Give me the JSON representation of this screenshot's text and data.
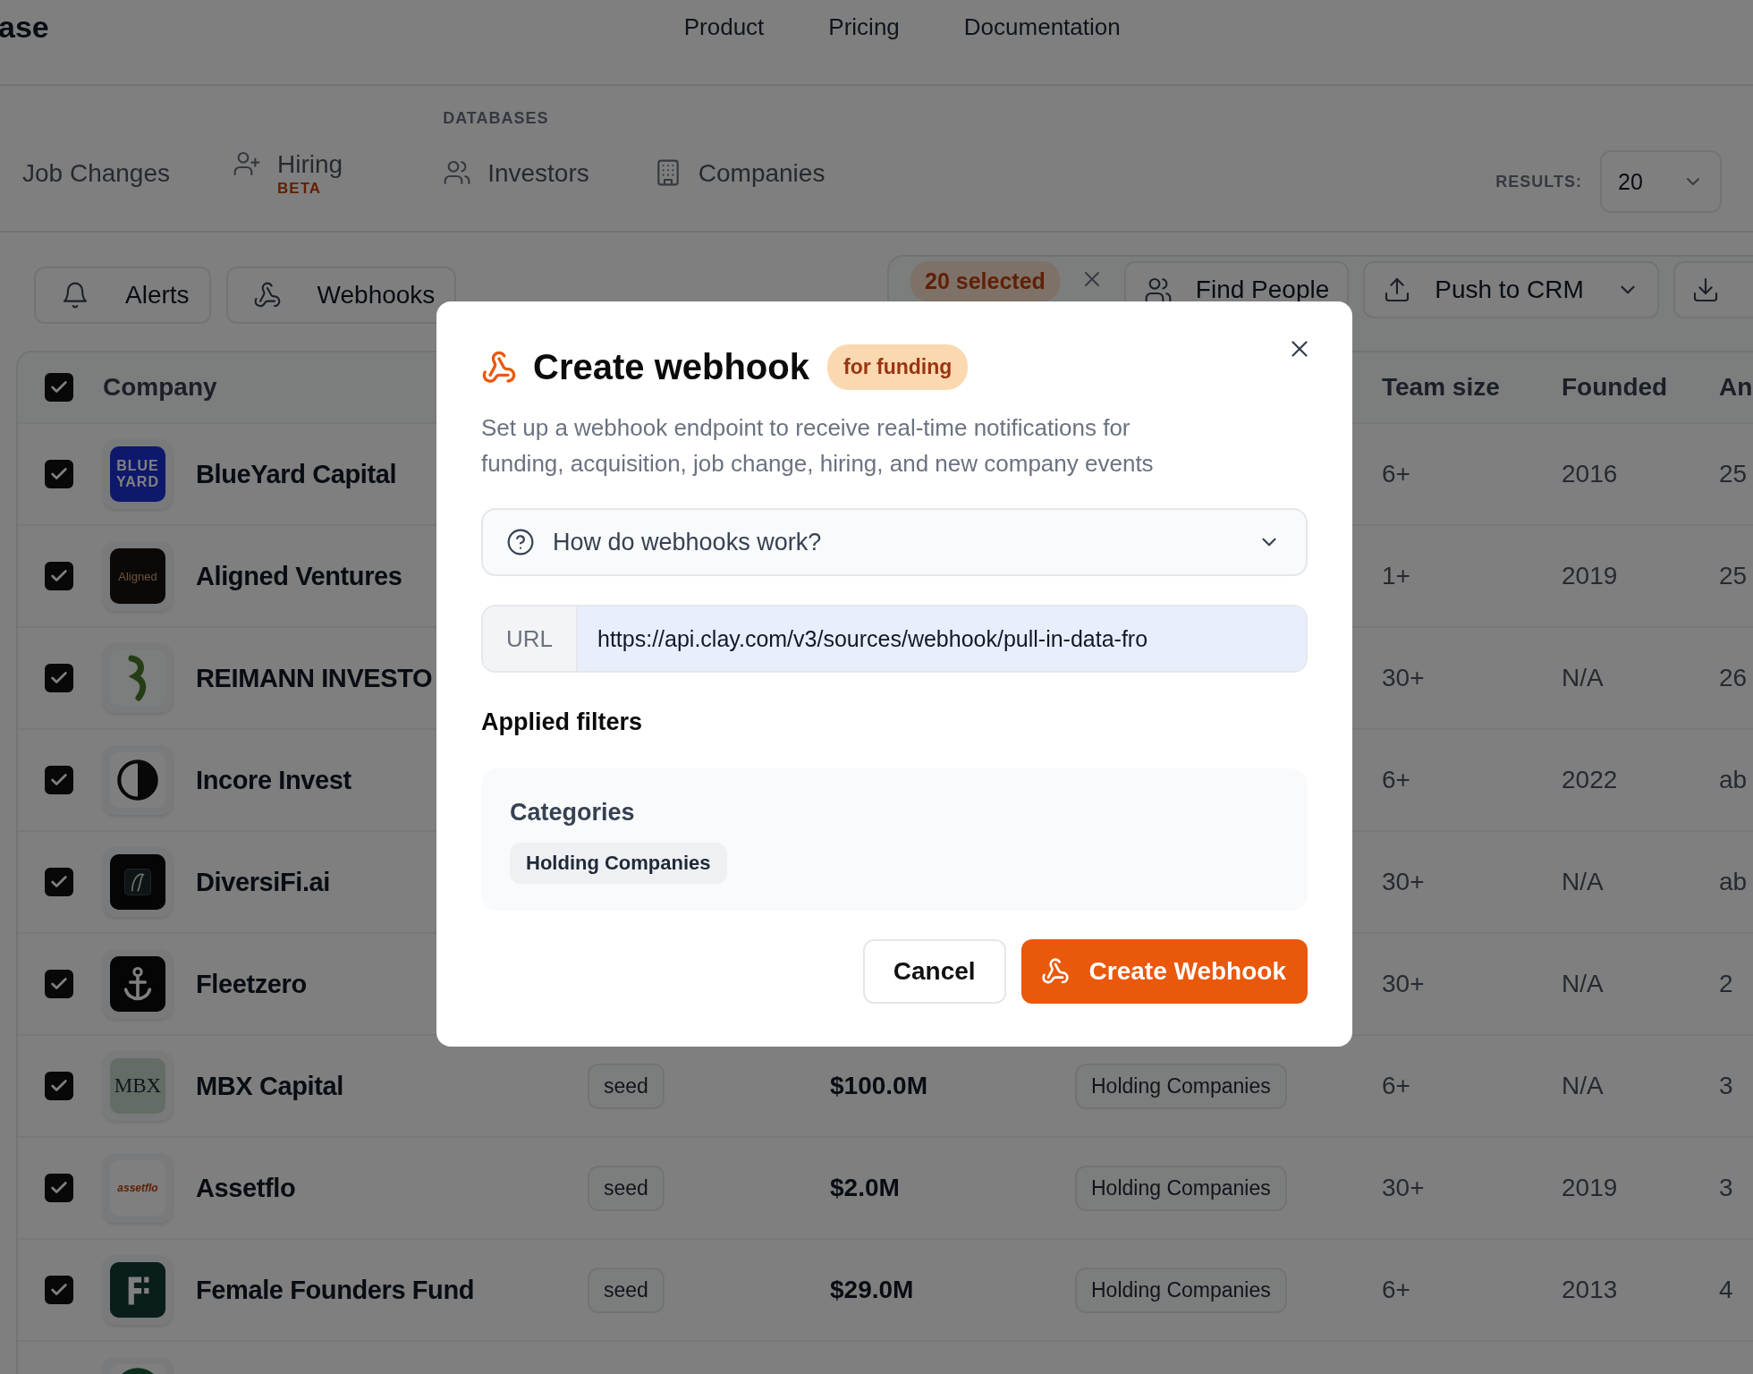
{
  "header": {
    "logo": "ase",
    "nav": [
      "Product",
      "Pricing",
      "Documentation"
    ]
  },
  "tab_groups": [
    {
      "tabs": [
        {
          "label": "Job Changes",
          "selected": false
        },
        {
          "label": "Hiring",
          "badge": "BETA",
          "selected": false
        }
      ]
    },
    {
      "heading": "DATABASES",
      "tabs": [
        {
          "label": "Investors",
          "selected": false
        },
        {
          "label": "Companies",
          "selected": false
        }
      ]
    }
  ],
  "results": {
    "label": "RESULTS:",
    "value": "20"
  },
  "toolbar": {
    "buttons": [
      "Alerts",
      "Webhooks"
    ],
    "selection": "20 selected",
    "actions": [
      {
        "label": "Find People",
        "has_menu": false
      },
      {
        "label": "Push to CRM",
        "has_menu": true
      }
    ]
  },
  "table": {
    "header": {
      "checked": true,
      "company": "Company",
      "team_size": "Team size",
      "founded": "Founded",
      "column_8": "An"
    },
    "rows": [
      {
        "checked": true,
        "logo": {
          "kind": "blue",
          "text": [
            "BLUE",
            "YARD"
          ]
        },
        "company": "BlueYard Capital",
        "team_size": "6+",
        "founded": "2016",
        "column_8": "25"
      },
      {
        "checked": true,
        "logo": {
          "kind": "dark",
          "text": [
            "Aligned"
          ]
        },
        "company": "Aligned Ventures",
        "team_size": "1+",
        "founded": "2019",
        "column_8": "25"
      },
      {
        "checked": true,
        "logo": {
          "kind": "hook"
        },
        "company": "REIMANN INVESTO",
        "team_size": "30+",
        "founded": "N/A",
        "column_8": "26"
      },
      {
        "checked": true,
        "logo": {
          "kind": "halfcircle"
        },
        "company": "Incore Invest",
        "team_size": "6+",
        "founded": "2022",
        "column_8": "ab"
      },
      {
        "checked": true,
        "logo": {
          "kind": "bird"
        },
        "company": "DiversiFi.ai",
        "team_size": "30+",
        "founded": "N/A",
        "column_8": "ab"
      },
      {
        "checked": true,
        "logo": {
          "kind": "anchor"
        },
        "company": "Fleetzero",
        "team_size": "30+",
        "founded": "N/A",
        "column_8": "2"
      },
      {
        "checked": true,
        "logo": {
          "kind": "mint",
          "text": [
            "MBX"
          ]
        },
        "company": "MBX Capital",
        "stage": "seed",
        "amount": "$100.0M",
        "category": "Holding Companies",
        "team_size": "6+",
        "founded": "N/A",
        "column_8": "3"
      },
      {
        "checked": true,
        "logo": {
          "kind": "light",
          "text": [
            "assetflo"
          ]
        },
        "company": "Assetflo",
        "stage": "seed",
        "amount": "$2.0M",
        "category": "Holding Companies",
        "team_size": "30+",
        "founded": "2019",
        "column_8": "3"
      },
      {
        "checked": true,
        "logo": {
          "kind": "blocks"
        },
        "company": "Female Founders Fund",
        "stage": "seed",
        "amount": "$29.0M",
        "category": "Holding Companies",
        "team_size": "6+",
        "founded": "2013",
        "column_8": "4"
      },
      {
        "logo": {
          "kind": "ring"
        }
      }
    ]
  },
  "modal": {
    "title": "Create webhook",
    "badge": "for funding",
    "description": "Set up a webhook endpoint to receive real-time notifications for funding, acquisition, job change, hiring, and new company events",
    "accordion": {
      "label": "How do webhooks work?",
      "expanded": false
    },
    "url": {
      "label": "URL",
      "value": "https://api.clay.com/v3/sources/webhook/pull-in-data-fro"
    },
    "filters_heading": "Applied filters",
    "filters": [
      {
        "label": "Categories",
        "values": [
          "Holding Companies"
        ]
      }
    ],
    "cancel": "Cancel",
    "submit": "Create Webhook"
  }
}
